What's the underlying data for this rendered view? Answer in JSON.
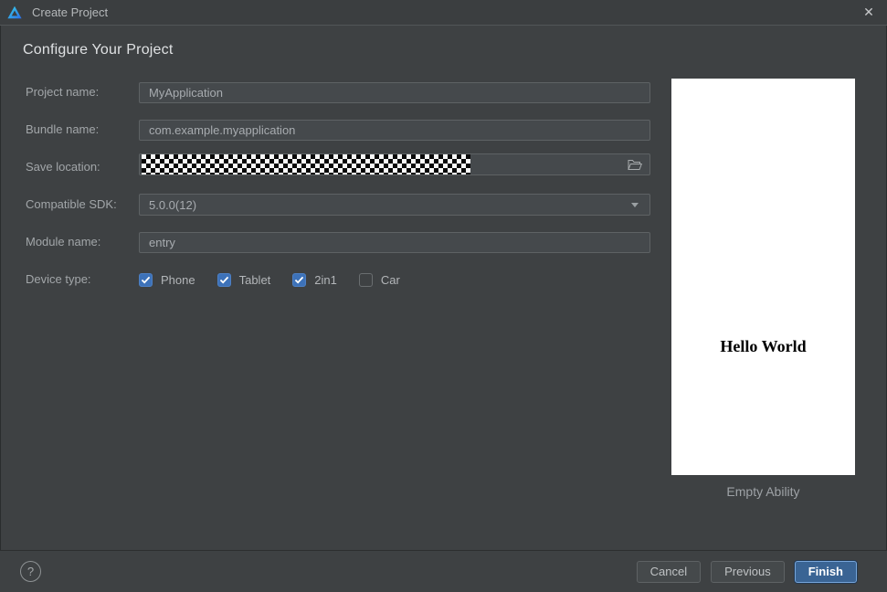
{
  "window": {
    "title": "Create Project"
  },
  "icons": {
    "close": "✕",
    "help": "?"
  },
  "header": {
    "title": "Configure Your Project"
  },
  "form": {
    "fields": [
      {
        "label": "Project name:",
        "value": "MyApplication",
        "type": "text"
      },
      {
        "label": "Bundle name:",
        "value": "com.example.myapplication",
        "type": "text"
      },
      {
        "label": "Save location:",
        "value": "",
        "type": "path",
        "redacted": true,
        "icon": "folder-icon"
      },
      {
        "label": "Compatible SDK:",
        "value": "5.0.0(12)",
        "type": "select"
      },
      {
        "label": "Module name:",
        "value": "entry",
        "type": "text"
      }
    ],
    "device_type": {
      "label": "Device type:",
      "options": [
        {
          "label": "Phone",
          "checked": true
        },
        {
          "label": "Tablet",
          "checked": true
        },
        {
          "label": "2in1",
          "checked": true
        },
        {
          "label": "Car",
          "checked": false
        }
      ]
    }
  },
  "preview": {
    "content": "Hello World",
    "caption": "Empty Ability"
  },
  "footer": {
    "buttons": [
      {
        "label": "Cancel"
      },
      {
        "label": "Previous"
      },
      {
        "label": "Finish",
        "primary": true
      }
    ]
  },
  "colors": {
    "accent_checkbox": "#3d72b9",
    "finish_button": "#3a6494",
    "dialog_bg": "#3e4143",
    "preview_bg": "#ffffff"
  }
}
